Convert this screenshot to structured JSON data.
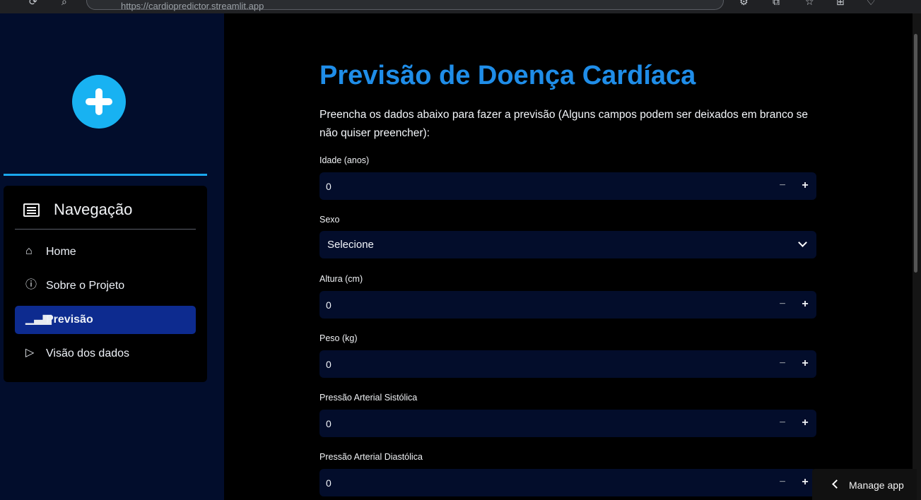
{
  "browser": {
    "url": "https://cardiopredictor.streamlit.app"
  },
  "sidebar": {
    "nav_title": "Navegação",
    "items": [
      {
        "label": "Home",
        "icon": "house-icon"
      },
      {
        "label": "Sobre o Projeto",
        "icon": "info-icon"
      },
      {
        "label": "Previsão",
        "icon": "bar-chart-icon",
        "active": true
      },
      {
        "label": "Visão dos dados",
        "icon": "play-icon"
      }
    ]
  },
  "main": {
    "title": "Previsão de Doença Cardíaca",
    "intro": "Preencha os dados abaixo para fazer a previsão (Alguns campos podem ser deixados em branco se não quiser preencher):",
    "fields": [
      {
        "label": "Idade (anos)",
        "value": "0"
      },
      {
        "label": "Sexo",
        "value": "Selecione"
      },
      {
        "label": "Altura (cm)",
        "value": "0"
      },
      {
        "label": "Peso (kg)",
        "value": "0"
      },
      {
        "label": "Pressão Arterial Sistólica",
        "value": "0"
      },
      {
        "label": "Pressão Arterial Diastólica",
        "value": "0"
      }
    ],
    "stepper_minus": "−",
    "stepper_plus": "+"
  },
  "manage_app": {
    "label": "Manage app"
  },
  "colors": {
    "sidebar_bg": "#020d2c",
    "active_nav": "#0d2b8f",
    "title": "#1f8de8",
    "accent": "#1aa7ee"
  }
}
